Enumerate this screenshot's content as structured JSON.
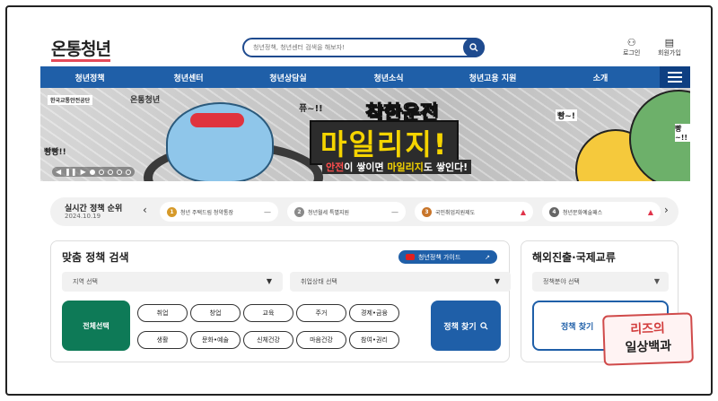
{
  "header": {
    "logo": "온통청년",
    "search_placeholder": "청년정책, 청년센터 검색을 해보자!",
    "login_label": "로그인",
    "signup_label": "회원가입"
  },
  "nav": {
    "items": [
      "청년정책",
      "청년센터",
      "청년상담실",
      "청년소식",
      "청년고용 지원",
      "소개"
    ]
  },
  "banner": {
    "logo_text": "한국교통안전공단",
    "logo2_text": "온통청년",
    "bubble_left_top": "퓨~!!",
    "bubble_left_bottom": "빵빵!!",
    "headline_top": "착한운전",
    "headline_main": "마일리지!",
    "sub_part1": "안전",
    "sub_part2": "이 쌓이면 ",
    "sub_part3": "마일리지",
    "sub_part4": "도 쌓인다!",
    "bubble_right1": "빵~!",
    "bubble_right2": "빵~!!",
    "slide_count": 5,
    "active_slide": 1
  },
  "ranking": {
    "title": "실시간 정책 순위",
    "date": "2024.10.19",
    "items": [
      {
        "rank": "1",
        "label": "청년 주택드림 청약통장",
        "trend": "—",
        "color": "#d69a2a"
      },
      {
        "rank": "2",
        "label": "청년월세 특별지원",
        "trend": "—",
        "color": "#8a8a8a"
      },
      {
        "rank": "3",
        "label": "국민취업지원제도",
        "trend": "▲",
        "color": "#c8752a"
      },
      {
        "rank": "4",
        "label": "청년문화예술패스",
        "trend": "▲",
        "color": "#666666"
      }
    ]
  },
  "search_panel": {
    "title": "맞춤 정책 검색",
    "guide_label": "청년정책 가이드",
    "region_select": "지역 선택",
    "status_select": "취업상태 선택",
    "all_label": "전체선택",
    "chips_row1": [
      "취업",
      "창업",
      "교육",
      "주거",
      "경제•금융"
    ],
    "chips_row2": [
      "생활",
      "문화•예술",
      "신체건강",
      "마음건강",
      "참여•권리"
    ],
    "find_label": "정책 찾기"
  },
  "overseas_panel": {
    "title": "해외진출·국제교류",
    "field_select": "정책분야 선택",
    "find_label": "정책 찾기"
  },
  "watermark": {
    "line1": "리즈의",
    "line2": "일상백과"
  },
  "colors": {
    "nav_blue": "#1f5fa8",
    "green_btn": "#0e7a57",
    "accent_red": "#e44b5a"
  }
}
